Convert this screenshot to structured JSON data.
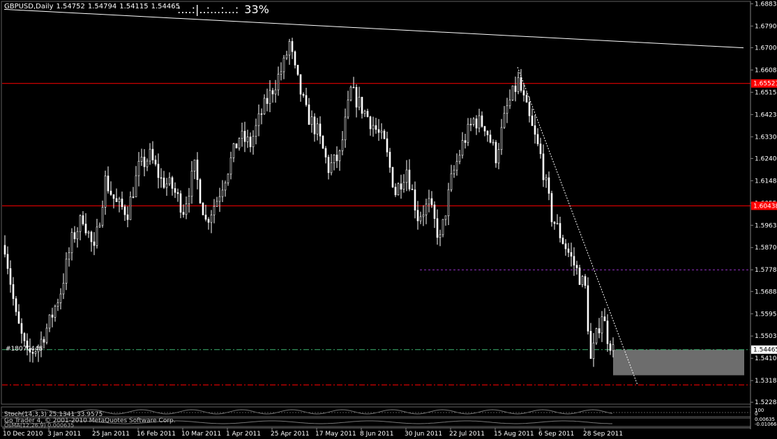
{
  "header": {
    "symbol_timeframe": "GBPUSD,Daily",
    "open": "1.54752",
    "high": "1.54794",
    "low": "1.54115",
    "close": "1.54465"
  },
  "progress": {
    "bar_text": ":...:|..:...:...:",
    "percent_text": "33%"
  },
  "order_label": "#18070448",
  "indicator_labels": {
    "stoch": "Stoch(14,3,3) 25.1341 33.9575",
    "copyright": "Go Trader 4, © 2001-2010 MetaQuotes Software Corp.",
    "osma": "OsMA(12,26,9) 0.000635"
  },
  "price_tags": {
    "r1": "1.65521",
    "r2": "1.60438",
    "current": "1.54465"
  },
  "subwindow_ticks": [
    "100",
    "0",
    "0.00635",
    "-0.01066"
  ],
  "colors": {
    "background": "#000000",
    "candles": "#ffffff",
    "resistance": "#ff0000",
    "support": "#3cb371",
    "purple": "#9932cc",
    "zone": "#808080",
    "trendline": "#ffffff"
  },
  "chart_data": {
    "type": "candlestick",
    "symbol": "GBPUSD",
    "timeframe": "Daily",
    "ylim": [
      1.522,
      1.689
    ],
    "y_ticks": [
      1.6883,
      1.67905,
      1.67005,
      1.6608,
      1.65155,
      1.6423,
      1.63305,
      1.62405,
      1.6148,
      1.60555,
      1.5963,
      1.58705,
      1.5778,
      1.5688,
      1.55955,
      1.5503,
      1.54105,
      1.5318,
      1.5228
    ],
    "x_tick_labels": [
      "10 Dec 2010",
      "3 Jan 2011",
      "25 Jan 2011",
      "16 Feb 2011",
      "10 Mar 2011",
      "1 Apr 2011",
      "25 Apr 2011",
      "17 May 2011",
      "8 Jun 2011",
      "30 Jun 2011",
      "22 Jul 2011",
      "15 Aug 2011",
      "6 Sep 2011",
      "28 Sep 2011"
    ],
    "x_tick_index": [
      0,
      16,
      32,
      48,
      64,
      80,
      96,
      112,
      128,
      144,
      160,
      176,
      192,
      208
    ],
    "horizontal_levels": [
      {
        "price": 1.65521,
        "style": "solid",
        "color": "#ff0000"
      },
      {
        "price": 1.60438,
        "style": "solid",
        "color": "#ff0000"
      },
      {
        "price": 1.5778,
        "style": "dashed",
        "color": "#9932cc",
        "from_index": 149
      },
      {
        "price": 1.54465,
        "style": "dashdot",
        "color": "#3cb371"
      },
      {
        "price": 1.53,
        "style": "dashdot",
        "color": "#ff0000"
      }
    ],
    "trendlines": [
      {
        "from": [
          0,
          1.686
        ],
        "to": [
          265,
          1.67
        ],
        "style": "solid"
      },
      {
        "from": [
          184,
          1.662
        ],
        "to": [
          227,
          1.53
        ],
        "style": "dotted"
      }
    ],
    "zone": {
      "from_index": 218,
      "to_index": 265,
      "top": 1.54465,
      "bottom": 1.534
    },
    "close_path": [
      [
        0,
        1.588
      ],
      [
        4,
        1.558
      ],
      [
        8,
        1.542
      ],
      [
        12,
        1.546
      ],
      [
        16,
        1.556
      ],
      [
        20,
        1.569
      ],
      [
        24,
        1.59
      ],
      [
        28,
        1.6
      ],
      [
        32,
        1.585
      ],
      [
        36,
        1.615
      ],
      [
        40,
        1.605
      ],
      [
        44,
        1.602
      ],
      [
        48,
        1.62
      ],
      [
        52,
        1.625
      ],
      [
        56,
        1.615
      ],
      [
        60,
        1.612
      ],
      [
        64,
        1.603
      ],
      [
        68,
        1.62
      ],
      [
        72,
        1.598
      ],
      [
        76,
        1.607
      ],
      [
        80,
        1.62
      ],
      [
        84,
        1.633
      ],
      [
        88,
        1.63
      ],
      [
        92,
        1.643
      ],
      [
        96,
        1.653
      ],
      [
        100,
        1.663
      ],
      [
        102,
        1.672
      ],
      [
        104,
        1.66
      ],
      [
        108,
        1.643
      ],
      [
        112,
        1.635
      ],
      [
        116,
        1.62
      ],
      [
        120,
        1.625
      ],
      [
        124,
        1.652
      ],
      [
        128,
        1.645
      ],
      [
        132,
        1.638
      ],
      [
        136,
        1.63
      ],
      [
        140,
        1.61
      ],
      [
        144,
        1.62
      ],
      [
        148,
        1.6
      ],
      [
        152,
        1.605
      ],
      [
        156,
        1.59
      ],
      [
        160,
        1.615
      ],
      [
        164,
        1.63
      ],
      [
        168,
        1.64
      ],
      [
        172,
        1.638
      ],
      [
        176,
        1.625
      ],
      [
        180,
        1.645
      ],
      [
        184,
        1.656
      ],
      [
        188,
        1.64
      ],
      [
        192,
        1.625
      ],
      [
        196,
        1.6
      ],
      [
        200,
        1.59
      ],
      [
        204,
        1.58
      ],
      [
        208,
        1.57
      ],
      [
        210,
        1.54
      ],
      [
        212,
        1.55
      ],
      [
        214,
        1.56
      ],
      [
        216,
        1.55
      ],
      [
        218,
        1.5447
      ]
    ]
  }
}
